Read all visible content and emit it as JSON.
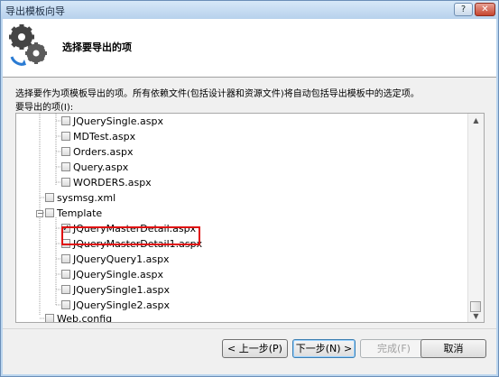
{
  "window": {
    "title": "导出模板向导",
    "help_label": "?",
    "close_label": "✕"
  },
  "header": {
    "title": "选择要导出的项",
    "icon": "gears-icon"
  },
  "description": "选择要作为项模板导出的项。所有依赖文件(包括设计器和资源文件)将自动包括导出模板中的选定项。",
  "items_label": "要导出的项(I):",
  "tree": {
    "items": [
      {
        "label": "JQuerySingle.aspx",
        "checked": false
      },
      {
        "label": "MDTest.aspx",
        "checked": false
      },
      {
        "label": "Orders.aspx",
        "checked": false
      },
      {
        "label": "Query.aspx",
        "checked": false
      },
      {
        "label": "WORDERS.aspx",
        "checked": false
      },
      {
        "label": "sysmsg.xml",
        "checked": false
      },
      {
        "label": "Template",
        "checked": false,
        "expander": "−"
      },
      {
        "label": "JQueryMasterDetail.aspx",
        "checked": true
      },
      {
        "label": "JQueryMasterDetail1.aspx",
        "checked": false
      },
      {
        "label": "JQueryQuery1.aspx",
        "checked": false
      },
      {
        "label": "JQuerySingle.aspx",
        "checked": false
      },
      {
        "label": "JQuerySingle1.aspx",
        "checked": false
      },
      {
        "label": "JQuerySingle2.aspx",
        "checked": false
      },
      {
        "label": "Web.config",
        "checked": false
      }
    ]
  },
  "buttons": {
    "prev": "< 上一步(P)",
    "next": "下一步(N) >",
    "finish": "完成(F)",
    "cancel": "取消"
  }
}
